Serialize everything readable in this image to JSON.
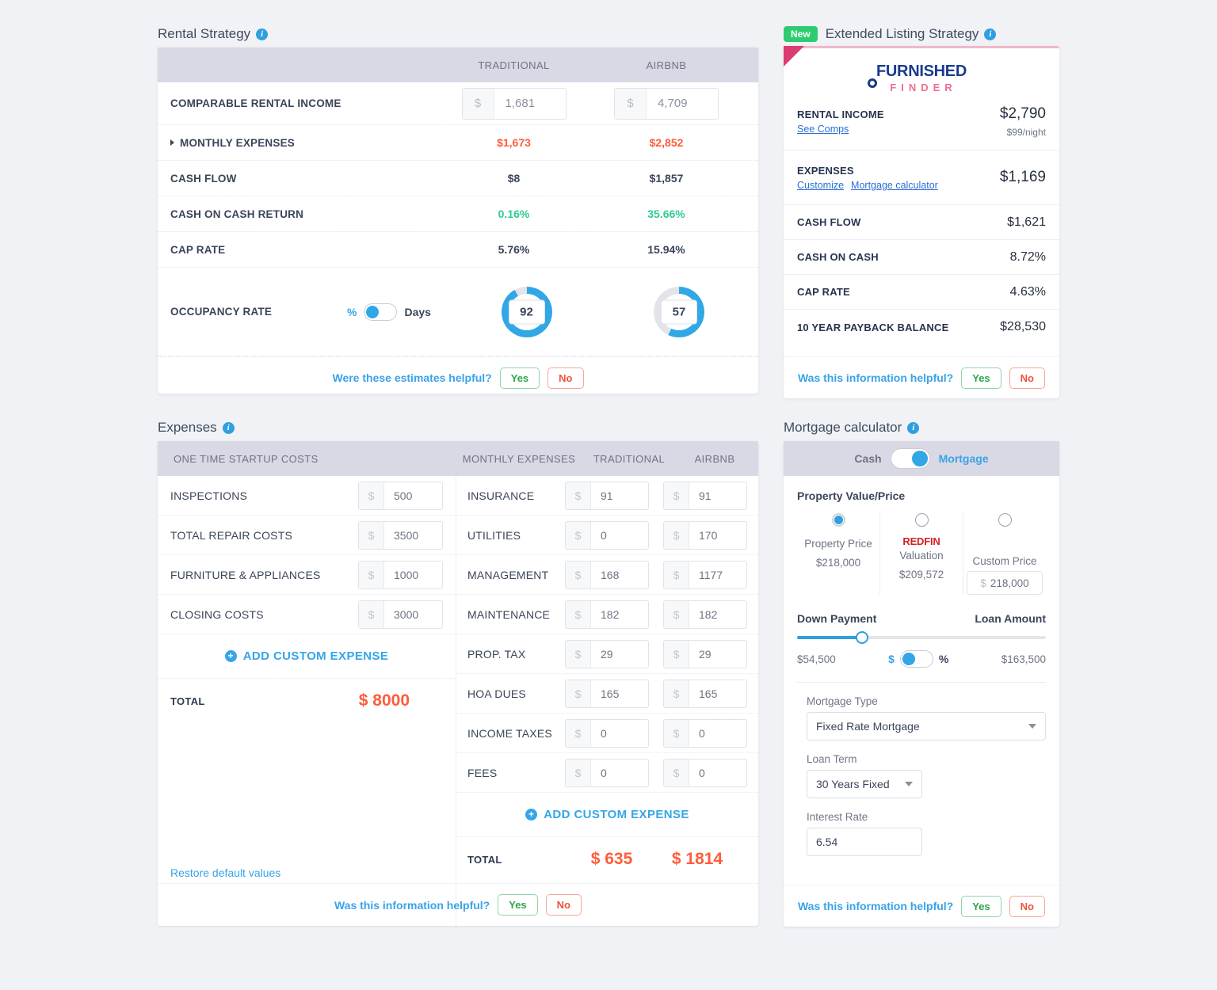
{
  "rental_strategy": {
    "title": "Rental Strategy",
    "columns": [
      "TRADITIONAL",
      "AIRBNB"
    ],
    "rows": [
      {
        "label": "COMPARABLE RENTAL INCOME",
        "type": "input",
        "prefix": "$",
        "traditional": "1,681",
        "airbnb": "4,709"
      },
      {
        "label": "MONTHLY EXPENSES",
        "type": "expandable",
        "traditional": "$1,673",
        "airbnb": "$2,852",
        "color": "red"
      },
      {
        "label": "CASH FLOW",
        "type": "text",
        "traditional": "$8",
        "airbnb": "$1,857",
        "color": "dark"
      },
      {
        "label": "CASH ON CASH RETURN",
        "type": "text",
        "traditional": "0.16%",
        "airbnb": "35.66%",
        "color": "green"
      },
      {
        "label": "CAP RATE",
        "type": "text",
        "traditional": "5.76%",
        "airbnb": "15.94%",
        "color": "dark"
      }
    ],
    "occupancy": {
      "label": "OCCUPANCY RATE",
      "unit_left": "%",
      "unit_right": "Days",
      "toggle_position": "left",
      "traditional_value": "92",
      "traditional_percent": 92,
      "airbnb_value": "57",
      "airbnb_percent": 57
    },
    "feedback": {
      "question": "Were these estimates helpful?",
      "yes": "Yes",
      "no": "No"
    }
  },
  "extended_listing": {
    "badge": "New",
    "title": "Extended Listing Strategy",
    "logo_top": "FURNISHED",
    "logo_bottom": "FINDER",
    "rows": [
      {
        "label": "RENTAL INCOME",
        "links": [
          "See Comps"
        ],
        "amount": "$2,790",
        "amount_sub": "$99/night",
        "color": "dark"
      },
      {
        "label": "EXPENSES",
        "links": [
          "Customize",
          "Mortgage calculator"
        ],
        "amount": "$1,169",
        "amount_sub": "",
        "color": "dark"
      },
      {
        "label": "CASH FLOW",
        "links": [],
        "amount": "$1,621",
        "amount_sub": "",
        "color": "dark"
      },
      {
        "label": "CASH ON CASH",
        "links": [],
        "amount": "8.72%",
        "amount_sub": "",
        "color": "green"
      },
      {
        "label": "CAP RATE",
        "links": [],
        "amount": "4.63%",
        "amount_sub": "",
        "color": "dark"
      },
      {
        "label": "10 YEAR PAYBACK BALANCE",
        "links": [],
        "amount": "$28,530",
        "amount_sub": "",
        "color": "dark"
      }
    ],
    "feedback": {
      "question": "Was this information helpful?",
      "yes": "Yes",
      "no": "No"
    }
  },
  "expenses": {
    "title": "Expenses",
    "headers": {
      "startup": "ONE TIME STARTUP COSTS",
      "monthly": "MONTHLY EXPENSES",
      "traditional": "TRADITIONAL",
      "airbnb": "AIRBNB"
    },
    "startup_rows": [
      {
        "label": "INSPECTIONS",
        "prefix": "$",
        "value": "500"
      },
      {
        "label": "TOTAL REPAIR COSTS",
        "prefix": "$",
        "value": "3500"
      },
      {
        "label": "FURNITURE & APPLIANCES",
        "prefix": "$",
        "value": "1000"
      },
      {
        "label": "CLOSING COSTS",
        "prefix": "$",
        "value": "3000"
      }
    ],
    "startup_add_label": "ADD CUSTOM EXPENSE",
    "startup_total_label": "TOTAL",
    "startup_total_value": "$ 8000",
    "restore_link": "Restore default values",
    "monthly_rows": [
      {
        "label": "INSURANCE",
        "prefix": "$",
        "traditional": "91",
        "airbnb": "91"
      },
      {
        "label": "UTILITIES",
        "prefix": "$",
        "traditional": "0",
        "airbnb": "170"
      },
      {
        "label": "MANAGEMENT",
        "prefix": "$",
        "traditional": "168",
        "airbnb": "1177"
      },
      {
        "label": "MAINTENANCE",
        "prefix": "$",
        "traditional": "182",
        "airbnb": "182"
      },
      {
        "label": "PROP. TAX",
        "prefix": "$",
        "traditional": "29",
        "airbnb": "29"
      },
      {
        "label": "HOA DUES",
        "prefix": "$",
        "traditional": "165",
        "airbnb": "165"
      },
      {
        "label": "INCOME TAXES",
        "prefix": "$",
        "traditional": "0",
        "airbnb": "0"
      },
      {
        "label": "FEES",
        "prefix": "$",
        "traditional": "0",
        "airbnb": "0"
      }
    ],
    "monthly_add_label": "ADD CUSTOM EXPENSE",
    "monthly_total_label": "TOTAL",
    "monthly_total_traditional": "$ 635",
    "monthly_total_airbnb": "$ 1814",
    "feedback": {
      "question": "Was this information helpful?",
      "yes": "Yes",
      "no": "No"
    }
  },
  "mortgage": {
    "title": "Mortgage calculator",
    "mode_left": "Cash",
    "mode_right": "Mortgage",
    "mode_selected": "Mortgage",
    "property_value_label": "Property Value/Price",
    "price_options": [
      {
        "label": "Property Price",
        "value": "$218,000",
        "selected": true,
        "logo": ""
      },
      {
        "label": "Valuation",
        "value": "$209,572",
        "selected": false,
        "logo": "REDFIN"
      },
      {
        "label": "Custom Price",
        "value": "218,000",
        "selected": false,
        "logo": "",
        "prefix": "$"
      }
    ],
    "down_payment_label": "Down Payment",
    "loan_amount_label": "Loan Amount",
    "down_payment_value": "$54,500",
    "loan_amount_value": "$163,500",
    "slider_percent": 26,
    "unit_left": "$",
    "unit_right": "%",
    "unit_toggle_position": "left",
    "mortgage_type_label": "Mortgage Type",
    "mortgage_type_value": "Fixed Rate Mortgage",
    "loan_term_label": "Loan Term",
    "loan_term_value": "30 Years Fixed",
    "interest_rate_label": "Interest Rate",
    "interest_rate_value": "6.54",
    "feedback": {
      "question": "Was this information helpful?",
      "yes": "Yes",
      "no": "No"
    }
  },
  "colors": {
    "accent_blue": "#38a3e8",
    "red": "#ff5c39",
    "green": "#2ecc8f",
    "header_bg": "#d8d9e4",
    "page_bg": "#f1f2f6",
    "badge_green": "#2ecc71",
    "ribbon_pink": "#da3d73"
  }
}
